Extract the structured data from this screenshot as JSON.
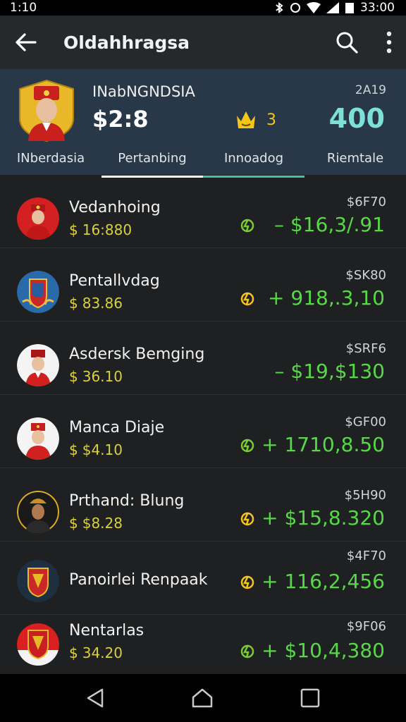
{
  "status": {
    "time": "1:10",
    "clock": "33:00"
  },
  "app": {
    "title": "Oldahhragsa"
  },
  "profile": {
    "name": "INabNGNDSIA",
    "balance": "$2:8",
    "badge_count": "3",
    "date": "2A19",
    "score": "400"
  },
  "tabs": [
    {
      "label": "INberdasia"
    },
    {
      "label": "Pertanbing"
    },
    {
      "label": "Innoadog"
    },
    {
      "label": "Riemtale"
    }
  ],
  "rows": [
    {
      "name": "Vedanhoing",
      "sub": "16:880",
      "small": "$6F70",
      "big": "– $16,3/.91",
      "avatar": "red-cap"
    },
    {
      "name": "Pentallvdag",
      "sub": "83.86",
      "small": "$SK80",
      "big": "+ 918,.3,10",
      "avatar": "crest-blue"
    },
    {
      "name": "Asdersk Bemging",
      "sub": "36.10",
      "small": "$SRF6",
      "big": "– $19,$130",
      "avatar": "red-cap-white"
    },
    {
      "name": "Manca Diaje",
      "sub": "$4.10",
      "small": "$GF00",
      "big": "+ 1710,8.50",
      "avatar": "red-cap-white2"
    },
    {
      "name": "Prthand: Blung",
      "sub": "$8.28",
      "small": "$5H90",
      "big": "+ $15,8.320",
      "avatar": "dark-portrait"
    },
    {
      "name": "Panoirlei Renpaak",
      "sub": "",
      "small": "$4F70",
      "big": "+ 116,2,456",
      "avatar": "crest-red"
    },
    {
      "name": "Nentarlas",
      "sub": "34.20",
      "small": "$9F06",
      "big": "+ $10,4,380",
      "avatar": "crest-red2"
    }
  ]
}
